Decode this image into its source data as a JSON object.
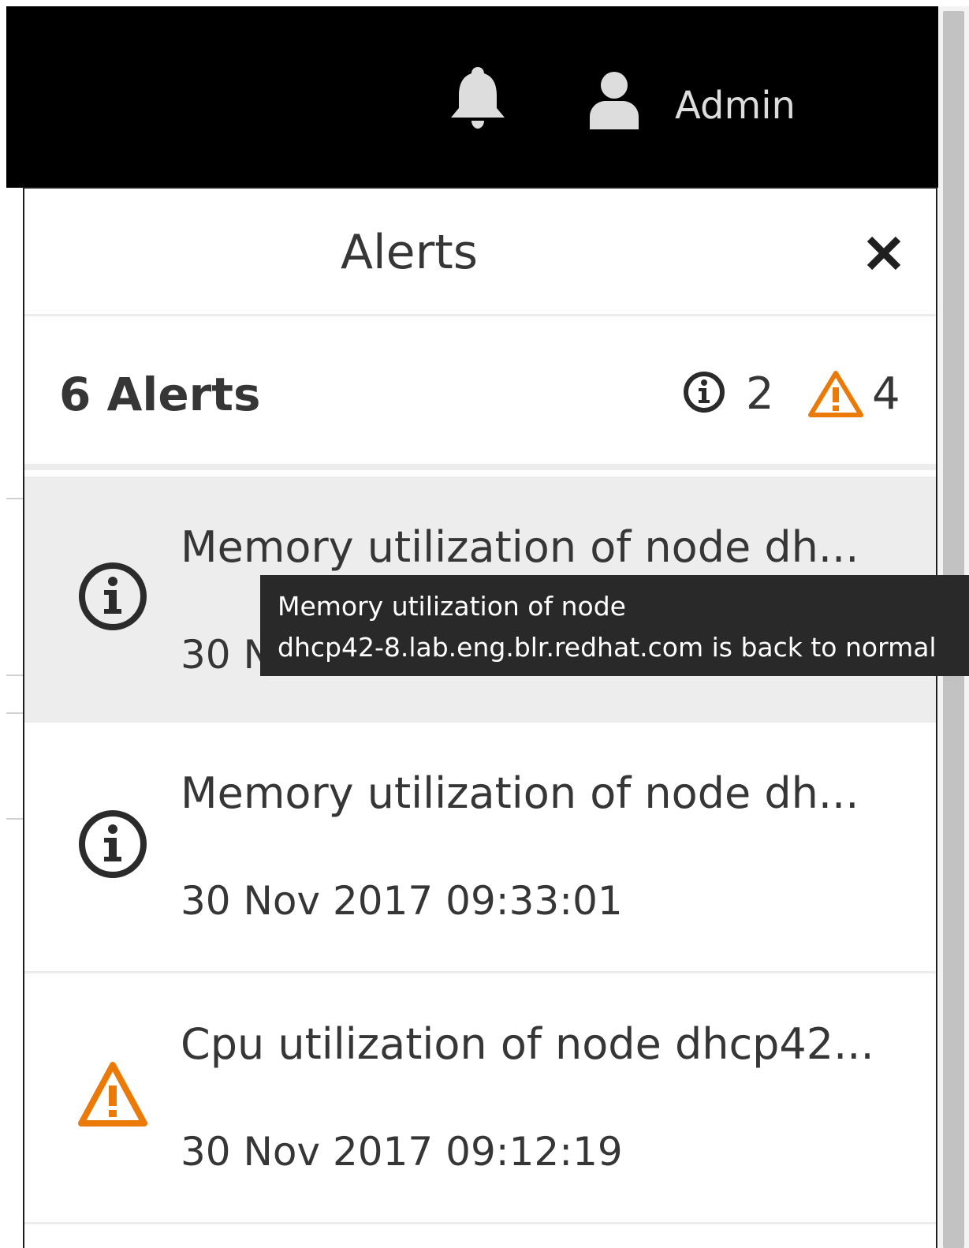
{
  "navbar": {
    "bell_icon": "bell-icon",
    "user_icon": "user-icon",
    "username": "Admin"
  },
  "drawer": {
    "title": "Alerts",
    "close_icon": "close-icon",
    "summary": {
      "title": "6 Alerts",
      "info_count": "2",
      "warning_count": "4"
    },
    "alerts": [
      {
        "severity": "info",
        "icon": "info-icon",
        "message": "Memory utilization of node dh...",
        "timestamp": "30 N"
      },
      {
        "severity": "info",
        "icon": "info-icon",
        "message": "Memory utilization of node dh...",
        "timestamp": "30 Nov 2017 09:33:01"
      },
      {
        "severity": "warning",
        "icon": "warning-icon",
        "message": "Cpu utilization of node dhcp42...",
        "timestamp": "30 Nov 2017 09:12:19"
      }
    ]
  },
  "tooltip": {
    "line1": "Memory utilization of node",
    "line2": "dhcp42-8.lab.eng.blr.redhat.com is back to normal"
  },
  "colors": {
    "navbar_bg": "#000000",
    "warning": "#ec7a08",
    "info": "#363636",
    "hover_row": "#ededed",
    "tooltip_bg": "#292929"
  }
}
